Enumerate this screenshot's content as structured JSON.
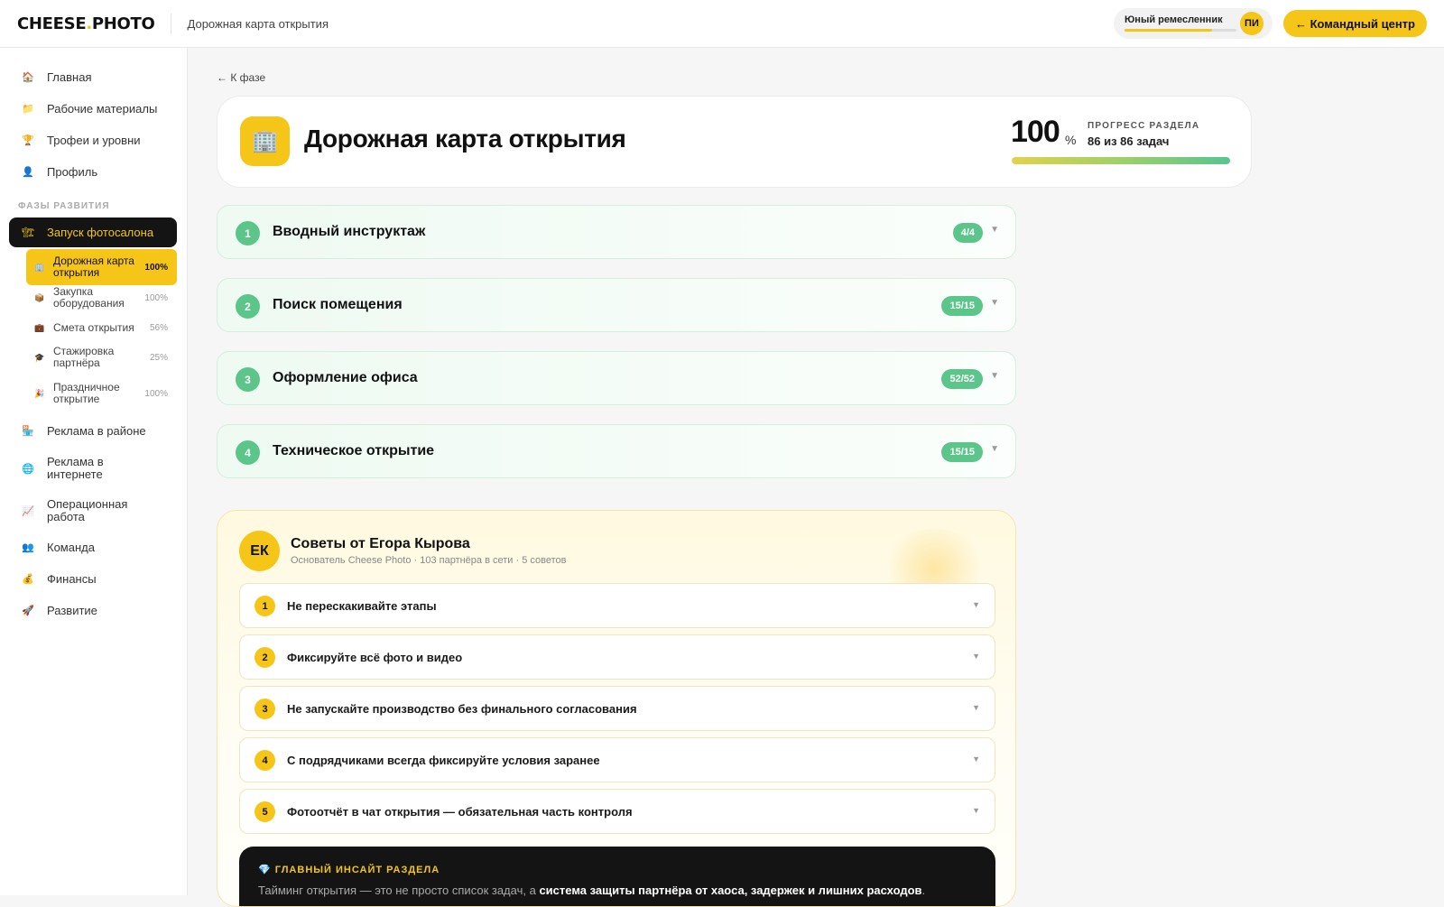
{
  "topbar": {
    "logo_left": "CHEESE",
    "logo_dot": ".",
    "logo_right": "PHOTO",
    "page_title": "Дорожная карта открытия",
    "rank_label": "Юный ремесленник",
    "rank_progress": 0.78,
    "avatar_initials": "ПИ",
    "command_center_label": "← Командный центр"
  },
  "sidebar": {
    "items_top": [
      {
        "icon": "🏠",
        "label": "Главная"
      },
      {
        "icon": "📁",
        "label": "Рабочие материалы"
      },
      {
        "icon": "🏆",
        "label": "Трофеи и уровни"
      },
      {
        "icon": "👤",
        "label": "Профиль"
      }
    ],
    "section_label": "ФАЗЫ РАЗВИТИЯ",
    "active_phase": {
      "icon": "🏗",
      "label": "Запуск фотосалона"
    },
    "sub_items": [
      {
        "icon": "🏢",
        "label": "Дорожная карта открытия",
        "pct": "100%"
      },
      {
        "icon": "📦",
        "label": "Закупка оборудования",
        "pct": "100%"
      },
      {
        "icon": "💼",
        "label": "Смета открытия",
        "pct": "56%"
      },
      {
        "icon": "🎓",
        "label": "Стажировка партнёра",
        "pct": "25%"
      },
      {
        "icon": "🎉",
        "label": "Праздничное открытие",
        "pct": "100%"
      }
    ],
    "items_bottom": [
      {
        "icon": "🏪",
        "label": "Реклама в районе"
      },
      {
        "icon": "🌐",
        "label": "Реклама в интернете"
      },
      {
        "icon": "📈",
        "label": "Операционная работа"
      },
      {
        "icon": "👥",
        "label": "Команда"
      },
      {
        "icon": "💰",
        "label": "Финансы"
      },
      {
        "icon": "🚀",
        "label": "Развитие"
      }
    ]
  },
  "main": {
    "back_link": "← К фазе",
    "hero": {
      "icon": "🏢",
      "title": "Дорожная карта открытия",
      "progress_value": "100",
      "progress_sign": "%",
      "progress_label": "ПРОГРЕСС РАЗДЕЛА",
      "progress_count": "86 из 86 задач",
      "progress_fraction": 1.0
    },
    "phases": [
      {
        "num": "1",
        "title": "Вводный инструктаж",
        "badge": "4/4"
      },
      {
        "num": "2",
        "title": "Поиск помещения",
        "badge": "15/15"
      },
      {
        "num": "3",
        "title": "Оформление офиса",
        "badge": "52/52"
      },
      {
        "num": "4",
        "title": "Техническое открытие",
        "badge": "15/15"
      }
    ],
    "tips": {
      "avatar": "ЕК",
      "title": "Советы от Егора Кырова",
      "subtitle": "Основатель Cheese Photo · 103 партнёра в сети · 5 советов",
      "items": [
        {
          "num": "1",
          "text": "Не перескакивайте этапы"
        },
        {
          "num": "2",
          "text": "Фиксируйте всё фото и видео"
        },
        {
          "num": "3",
          "text": "Не запускайте производство без финального согласования"
        },
        {
          "num": "4",
          "text": "С подрядчиками всегда фиксируйте условия заранее"
        },
        {
          "num": "5",
          "text": "Фотоотчёт в чат открытия — обязательная часть контроля"
        }
      ],
      "insight": {
        "label": "💎 ГЛАВНЫЙ ИНСАЙТ РАЗДЕЛА",
        "text_start": "Тайминг открытия — это не просто список задач, а ",
        "text_bold": "система защиты партнёра от хаоса, задержек и лишних расходов",
        "text_end": "."
      }
    }
  },
  "colors": {
    "accent": "#f5c518",
    "success": "#5cc68a",
    "dark": "#141414"
  }
}
